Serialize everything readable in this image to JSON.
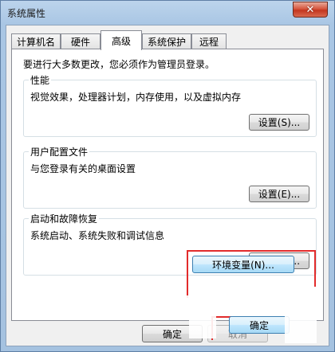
{
  "window": {
    "title": "系统属性",
    "close_glyph": "✕"
  },
  "tabs": [
    {
      "label": "计算机名",
      "active": false
    },
    {
      "label": "硬件",
      "active": false
    },
    {
      "label": "高级",
      "active": true
    },
    {
      "label": "系统保护",
      "active": false
    },
    {
      "label": "远程",
      "active": false
    }
  ],
  "advanced": {
    "admin_note": "要进行大多数更改，您必须作为管理员登录。",
    "performance": {
      "title": "性能",
      "description": "视觉效果，处理器计划，内存使用，以及虚拟内存",
      "settings_label": "设置(S)..."
    },
    "user_profiles": {
      "title": "用户配置文件",
      "description": "与您登录有关的桌面设置",
      "settings_label": "设置(E)..."
    },
    "startup_recovery": {
      "title": "启动和故障恢复",
      "description": "系统启动、系统失败和调试信息",
      "settings_label": "设置(T)..."
    },
    "env_vars_label": "环境变量(N)..."
  },
  "footer": {
    "ok_label": "确定",
    "cancel_label": "取消",
    "ok_zoomed_label": "确定"
  },
  "colors": {
    "highlight": "#e22b2b",
    "close": "#c3361f"
  }
}
